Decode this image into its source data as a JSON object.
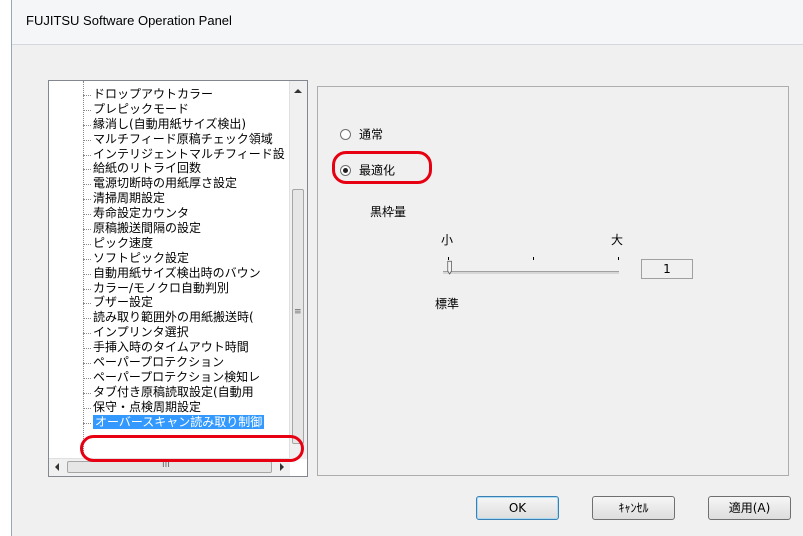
{
  "window": {
    "title": "FUJITSU Software Operation Panel"
  },
  "tree": {
    "items": [
      "ドロップアウトカラー",
      "プレピックモード",
      "縁消し(自動用紙サイズ検出)",
      "マルチフィード原稿チェック領域",
      "インテリジェントマルチフィード設",
      "給紙のリトライ回数",
      "電源切断時の用紙厚さ設定",
      "清掃周期設定",
      "寿命設定カウンタ",
      "原稿搬送間隔の設定",
      "ピック速度",
      "ソフトピック設定",
      "自動用紙サイズ検出時のバウン",
      "カラー/モノクロ自動判別",
      "ブザー設定",
      "読み取り範囲外の用紙搬送時(",
      "インプリンタ選択",
      "手挿入時のタイムアウト時間",
      "ペーパープロテクション",
      "ペーパープロテクション検知レ",
      "タブ付き原稿読取設定(自動用",
      "保守・点検周期設定",
      "オーバースキャン読み取り制御"
    ],
    "selected_index": 22,
    "scrollbar_h_glyph": "III",
    "scrollbar_v_glyph": "≡"
  },
  "settings": {
    "radio_normal": "通常",
    "radio_optimize": "最適化",
    "selected_option": "最適化",
    "frame_label": "黒枠量",
    "slider": {
      "min_label": "小",
      "max_label": "大",
      "center_label": "標準",
      "value": "1"
    }
  },
  "buttons": {
    "ok": "OK",
    "cancel": "ｷｬﾝｾﾙ",
    "apply": "適用(A)"
  },
  "colors": {
    "highlight": "#e60012",
    "selection": "#3399ff"
  }
}
